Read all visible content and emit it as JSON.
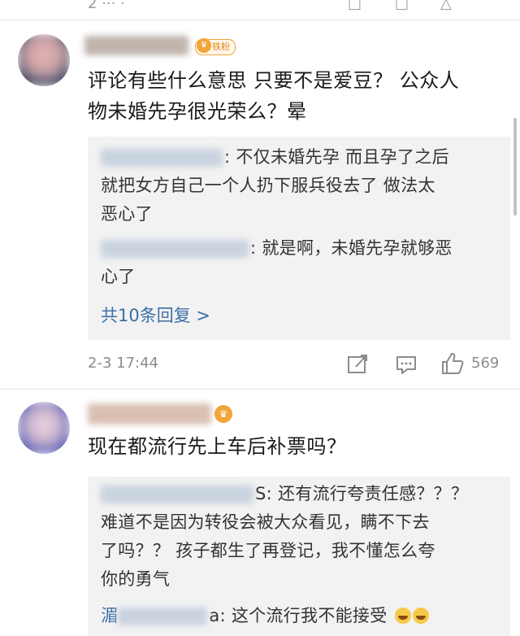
{
  "colors": {
    "link": "#3b6ea8",
    "badge": "#f0a23a",
    "reply_bg": "#f2f2f2",
    "meta_text": "#8c8c8c"
  },
  "comments": [
    {
      "badge_label": "铁粉",
      "text_line1": "评论有些什么意思 只要不是爱豆？ 公众人",
      "text_line2": "物未婚先孕很光荣么？晕",
      "replies": [
        {
          "line1": ": 不仅未婚先孕 而且孕了之后",
          "line2": "就把女方自己一个人扔下服兵役去了 做法太",
          "line3": "恶心了"
        },
        {
          "line1": ": 就是啊，未婚先孕就够恶",
          "line2": "心了"
        }
      ],
      "more_replies": "共10条回复 >",
      "timestamp": "2-3 17:44",
      "likes": "569",
      "icons": [
        "share-icon",
        "comment-icon",
        "like-icon"
      ]
    },
    {
      "badge_label": "",
      "text_line1": "现在都流行先上车后补票吗？",
      "replies": [
        {
          "line1": "S: 还有流行夸责任感？？？",
          "line2": "难道不是因为转役会被大众看见，瞒不下去",
          "line3": "了吗？？ 孩子都生了再登记，我不懂怎么夸",
          "line4": "你的勇气"
        },
        {
          "prefix": "湄",
          "line1": "a: 这个流行我不能接受"
        }
      ]
    }
  ]
}
